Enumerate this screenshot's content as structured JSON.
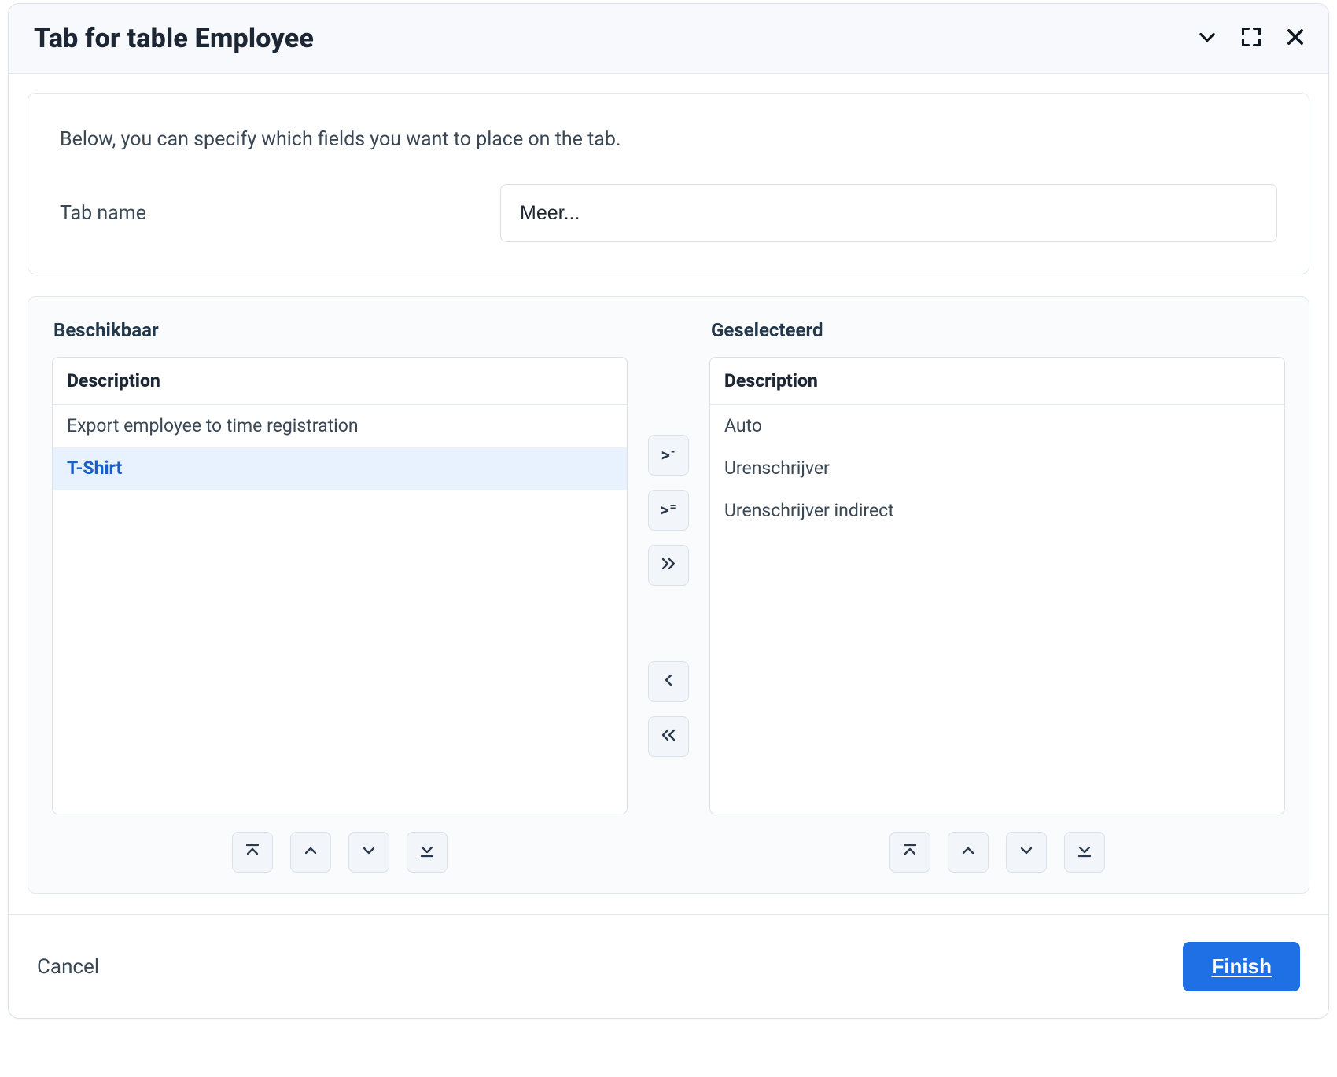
{
  "title": "Tab for table Employee",
  "intro": "Below, you can specify which fields you want to place on the tab.",
  "tabName": {
    "label": "Tab name",
    "value": "Meer..."
  },
  "available": {
    "title": "Beschikbaar",
    "column": "Description",
    "items": [
      {
        "label": "Export employee to time registration",
        "selected": false
      },
      {
        "label": "T-Shirt",
        "selected": true
      }
    ]
  },
  "selected": {
    "title": "Geselecteerd",
    "column": "Description",
    "items": [
      {
        "label": "Auto"
      },
      {
        "label": "Urenschrijver"
      },
      {
        "label": "Urenschrijver indirect"
      }
    ]
  },
  "footer": {
    "cancel": "Cancel",
    "finish": "Finish"
  }
}
